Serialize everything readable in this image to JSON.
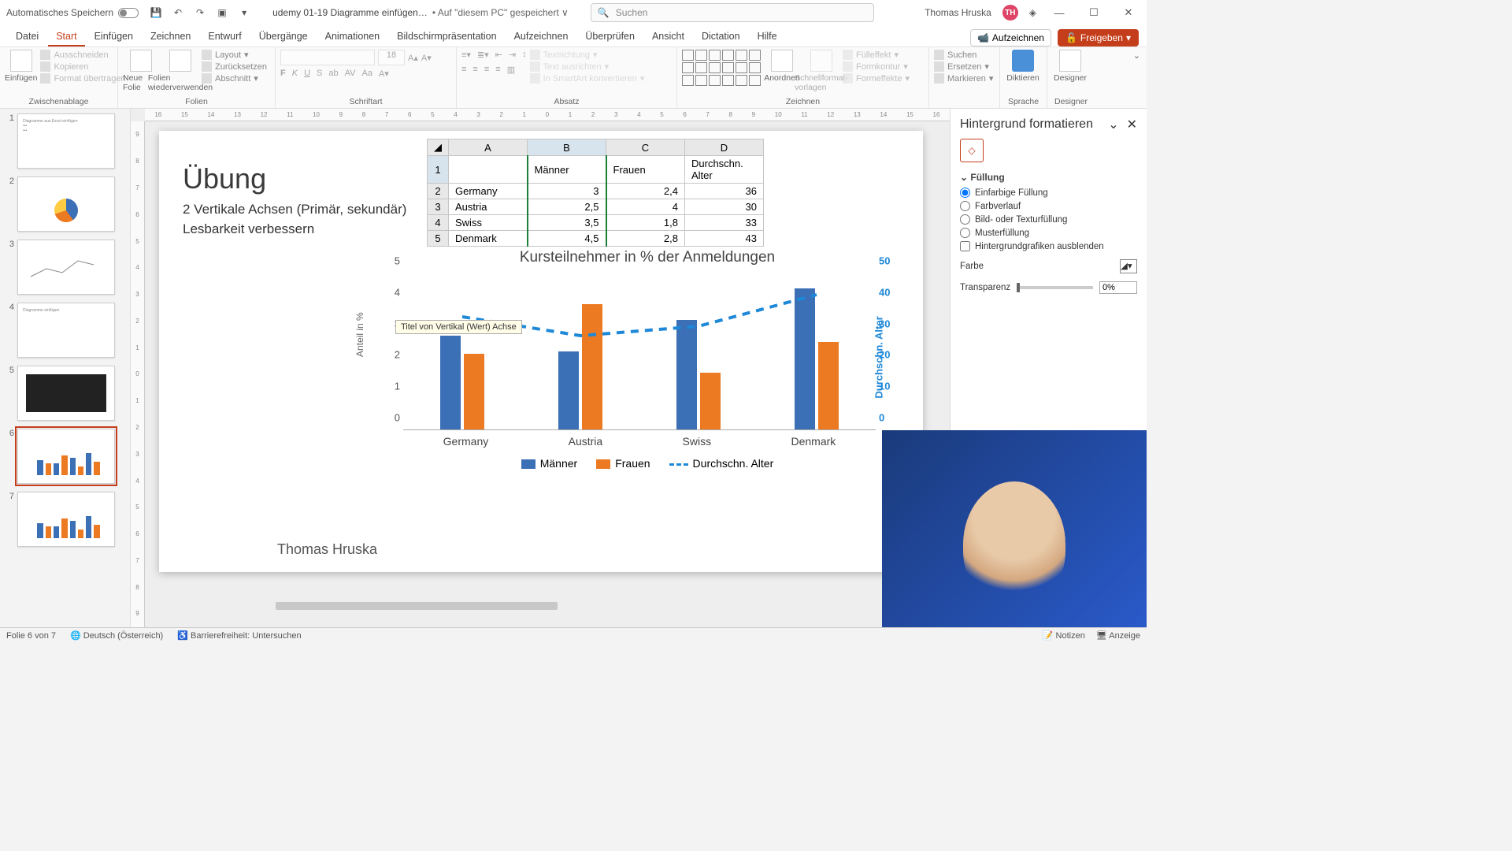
{
  "titlebar": {
    "autosave_label": "Automatisches Speichern",
    "filename": "udemy 01-19 Diagramme einfügen…",
    "saved_hint": "• Auf \"diesem PC\" gespeichert ∨",
    "search_placeholder": "Suchen",
    "user_name": "Thomas Hruska",
    "user_initials": "TH"
  },
  "tabs": {
    "items": [
      "Datei",
      "Start",
      "Einfügen",
      "Zeichnen",
      "Entwurf",
      "Übergänge",
      "Animationen",
      "Bildschirmpräsentation",
      "Aufzeichnen",
      "Überprüfen",
      "Ansicht",
      "Dictation",
      "Hilfe"
    ],
    "active_index": 1,
    "record_btn": "Aufzeichnen",
    "share_btn": "Freigeben"
  },
  "ribbon": {
    "clipboard": {
      "paste": "Einfügen",
      "cut": "Ausschneiden",
      "copy": "Kopieren",
      "format": "Format übertragen",
      "label": "Zwischenablage"
    },
    "slides": {
      "new": "Neue Folie",
      "reuse": "Folien wiederverwenden",
      "layout": "Layout",
      "reset": "Zurücksetzen",
      "section": "Abschnitt",
      "label": "Folien"
    },
    "font": {
      "size": "18",
      "label": "Schriftart"
    },
    "para": {
      "direction": "Textrichtung",
      "align": "Text ausrichten",
      "smartart": "In SmartArt konvertieren",
      "label": "Absatz"
    },
    "draw": {
      "arrange": "Anordnen",
      "quick": "Schnellformat-vorlagen",
      "fill": "Fülleffekt",
      "outline": "Formkontur",
      "effects": "Formeffekte",
      "label": "Zeichnen"
    },
    "edit": {
      "find": "Suchen",
      "replace": "Ersetzen",
      "select": "Markieren"
    },
    "dict": {
      "label": "Diktieren",
      "group": "Sprache"
    },
    "designer": {
      "label": "Designer"
    }
  },
  "thumbs": {
    "count": 7,
    "active": 6
  },
  "slide": {
    "title": "Übung",
    "sub1": "2 Vertikale Achsen (Primär, sekundär)",
    "sub2": "Lesbarkeit verbessern",
    "tooltip": "Titel von Vertikal (Wert) Achse",
    "footer": "Thomas Hruska"
  },
  "sheet": {
    "cols": [
      "A",
      "B",
      "C",
      "D"
    ],
    "headers_row": [
      "",
      "Männer",
      "Frauen",
      "Durchschn. Alter"
    ],
    "rows": [
      {
        "n": "2",
        "label": "Germany",
        "m": "3",
        "f": "2,4",
        "a": "36"
      },
      {
        "n": "3",
        "label": "Austria",
        "m": "2,5",
        "f": "4",
        "a": "30"
      },
      {
        "n": "4",
        "label": "Swiss",
        "m": "3,5",
        "f": "1,8",
        "a": "33"
      },
      {
        "n": "5",
        "label": "Denmark",
        "m": "4,5",
        "f": "2,8",
        "a": "43"
      }
    ]
  },
  "chart_data": {
    "type": "bar",
    "title": "Kursteilnehmer in % der Anmeldungen",
    "categories": [
      "Germany",
      "Austria",
      "Swiss",
      "Denmark"
    ],
    "series": [
      {
        "name": "Männer",
        "values": [
          3,
          2.5,
          3.5,
          4.5
        ],
        "axis": "primary",
        "kind": "bar",
        "color": "#3b6fb6"
      },
      {
        "name": "Frauen",
        "values": [
          2.4,
          4,
          1.8,
          2.8
        ],
        "axis": "primary",
        "kind": "bar",
        "color": "#ec7a22"
      },
      {
        "name": "Durchschn. Alter",
        "values": [
          36,
          30,
          33,
          43
        ],
        "axis": "secondary",
        "kind": "line",
        "color": "#1e88d8",
        "dash": true
      }
    ],
    "ylabel": "Anteil in %",
    "ylim": [
      0,
      5
    ],
    "y2label": "Durchschn. Alter",
    "y2lim": [
      0,
      50
    ],
    "legend": [
      "Männer",
      "Frauen",
      "Durchschn. Alter"
    ]
  },
  "panel": {
    "title": "Hintergrund formatieren",
    "section": "Füllung",
    "opts": {
      "solid": "Einfarbige Füllung",
      "gradient": "Farbverlauf",
      "picture": "Bild- oder Texturfüllung",
      "pattern": "Musterfüllung",
      "hide": "Hintergrundgrafiken ausblenden"
    },
    "color_label": "Farbe",
    "transparency_label": "Transparenz",
    "transparency_value": "0%"
  },
  "status": {
    "slide_info": "Folie 6 von 7",
    "lang": "Deutsch (Österreich)",
    "access": "Barrierefreiheit: Untersuchen",
    "notes": "Notizen",
    "display": "Anzeige"
  },
  "ruler_h": [
    "16",
    "15",
    "14",
    "13",
    "12",
    "11",
    "10",
    "9",
    "8",
    "7",
    "6",
    "5",
    "4",
    "3",
    "2",
    "1",
    "0",
    "1",
    "2",
    "3",
    "4",
    "5",
    "6",
    "7",
    "8",
    "9",
    "10",
    "11",
    "12",
    "13",
    "14",
    "15",
    "16"
  ],
  "ruler_v": [
    "9",
    "8",
    "7",
    "6",
    "5",
    "4",
    "3",
    "2",
    "1",
    "0",
    "1",
    "2",
    "3",
    "4",
    "5",
    "6",
    "7",
    "8",
    "9"
  ]
}
